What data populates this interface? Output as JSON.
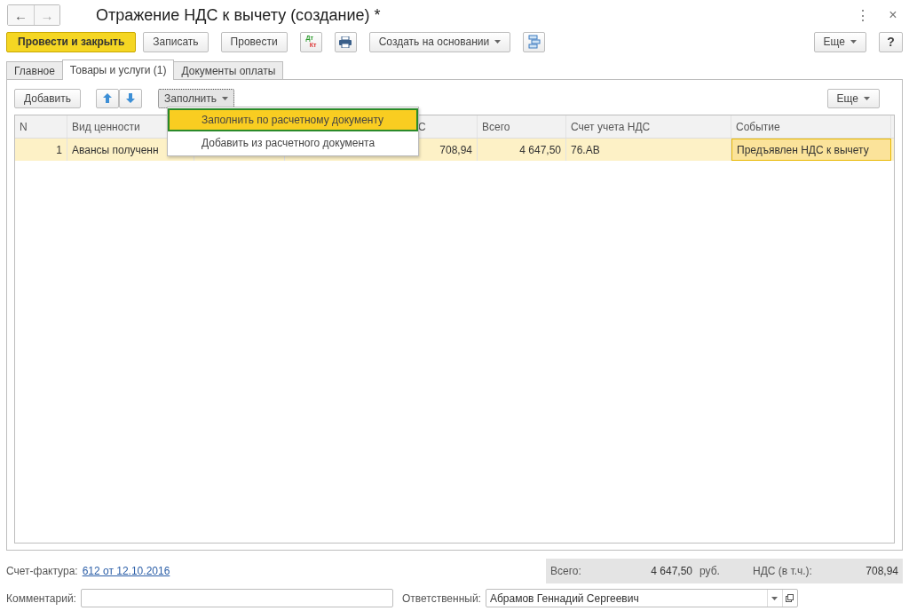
{
  "window": {
    "title": "Отражение НДС к вычету (создание) *",
    "nav": [
      "←",
      "→"
    ],
    "actions": [
      "⋮",
      "×"
    ]
  },
  "toolbar": {
    "buttons": [
      {
        "label": "Провести и закрыть",
        "kind": "primary"
      },
      {
        "label": "Записать",
        "kind": "plain"
      },
      {
        "label": "Провести",
        "kind": "plain"
      },
      {
        "kind": "dtkt",
        "top": "Дт",
        "bottom": "Кт"
      },
      {
        "kind": "print"
      },
      {
        "label": "Создать на основании",
        "kind": "dropdown"
      },
      {
        "kind": "structure"
      }
    ],
    "right": [
      {
        "label": "Еще",
        "kind": "dropdown"
      },
      {
        "label": "?",
        "kind": "plain"
      }
    ]
  },
  "tabs": [
    {
      "label": "Главное",
      "selected": false
    },
    {
      "label": "Товары и услуги (1)",
      "selected": true
    },
    {
      "label": "Документы оплаты",
      "selected": false
    }
  ],
  "table_toolbar": {
    "add": "Добавить",
    "fill": "Заполнить",
    "more": "Еще"
  },
  "fill_menu": {
    "items": [
      {
        "label": "Заполнить по расчетному документу",
        "selected": true
      },
      {
        "label": "Добавить из расчетного документа",
        "selected": false
      }
    ]
  },
  "table": {
    "columns": [
      "N",
      "Вид ценности",
      "С",
      "Всего",
      "Счет учета НДС",
      "Событие"
    ],
    "rows": [
      {
        "selected": true,
        "cells": [
          "1",
          "Авансы полученн",
          "708,94",
          "4 647,50",
          "76.АВ",
          "Предъявлен НДС к вычету"
        ],
        "event_cell_active": true
      }
    ]
  },
  "footer": {
    "invoice_label": "Счет-фактура:",
    "invoice_link": "612 от 12.10.2016",
    "total_label": "Всего:",
    "total": "4 647,50",
    "currency": "руб.",
    "vat_label": "НДС (в т.ч.):",
    "vat": "708,94",
    "comment_label": "Комментарий:",
    "responsible_label": "Ответственный:",
    "responsible": "Абрамов Геннадий Сергеевич"
  }
}
